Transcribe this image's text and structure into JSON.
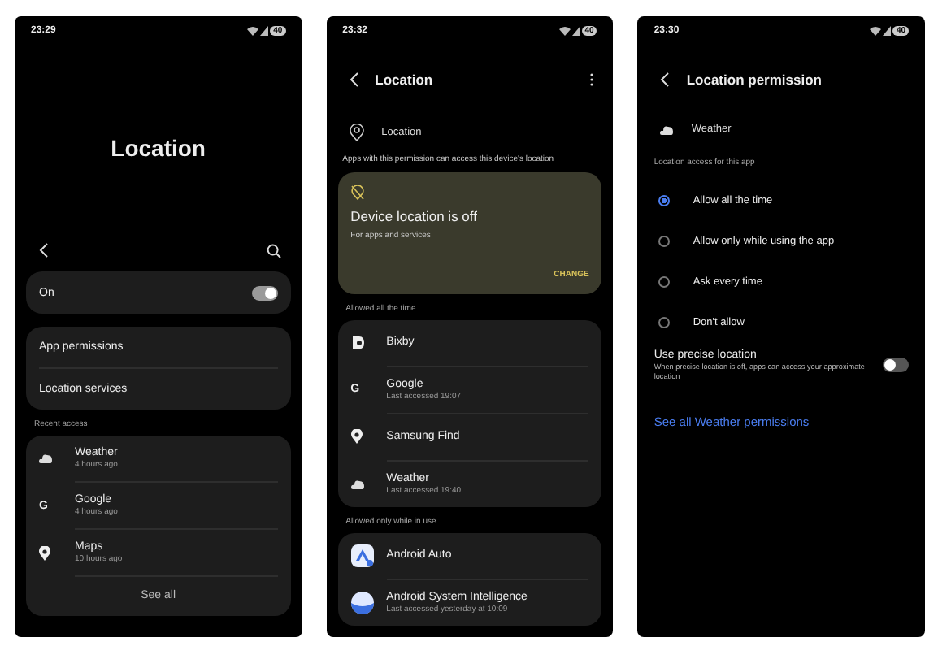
{
  "location_screen": {
    "status_time": "23:29",
    "battery": "40",
    "title": "Location",
    "master_switch": {
      "label": "On",
      "on": true
    },
    "menu_items": [
      "App permissions",
      "Location services"
    ],
    "recent_heading": "Recent access",
    "recent": [
      {
        "kind": "cloud",
        "name": "Weather",
        "detail": "4 hours ago"
      },
      {
        "kind": "letter",
        "glyph": "G",
        "name": "Google",
        "detail": "4 hours ago"
      },
      {
        "kind": "pin",
        "name": "Maps",
        "detail": "10 hours ago"
      }
    ],
    "see_all": "See all"
  },
  "permission_screen": {
    "status_time": "23:32",
    "battery": "40",
    "title": "Location",
    "permission_label": "Location",
    "description": "Apps with this permission can access this device's location",
    "notice": {
      "title": "Device location is off",
      "text": "For apps and services",
      "action": "CHANGE"
    },
    "groups": [
      {
        "heading": "Allowed all the time",
        "apps": [
          {
            "kind": "bixby",
            "name": "Bixby"
          },
          {
            "kind": "letter",
            "glyph": "G",
            "name": "Google",
            "detail": "Last accessed 19:07"
          },
          {
            "kind": "pin",
            "name": "Samsung Find"
          },
          {
            "kind": "cloud",
            "name": "Weather",
            "detail": "Last accessed 19:40"
          }
        ]
      },
      {
        "heading": "Allowed only while in use",
        "apps": [
          {
            "kind": "auto",
            "name": "Android Auto"
          },
          {
            "kind": "sphere",
            "name": "Android System Intelligence",
            "detail": "Last accessed yesterday at 10:09"
          }
        ]
      }
    ]
  },
  "app_screen": {
    "status_time": "23:30",
    "battery": "40",
    "title": "Location permission",
    "app_name": "Weather",
    "access_heading": "Location access for this app",
    "options": [
      {
        "label": "Allow all the time",
        "selected": true
      },
      {
        "label": "Allow only while using the app",
        "selected": false
      },
      {
        "label": "Ask every time",
        "selected": false
      },
      {
        "label": "Don't allow",
        "selected": false
      }
    ],
    "precise": {
      "label": "Use precise location",
      "description": "When precise location is off, apps can access your approximate location",
      "on": false
    },
    "link": "See all Weather permissions"
  }
}
